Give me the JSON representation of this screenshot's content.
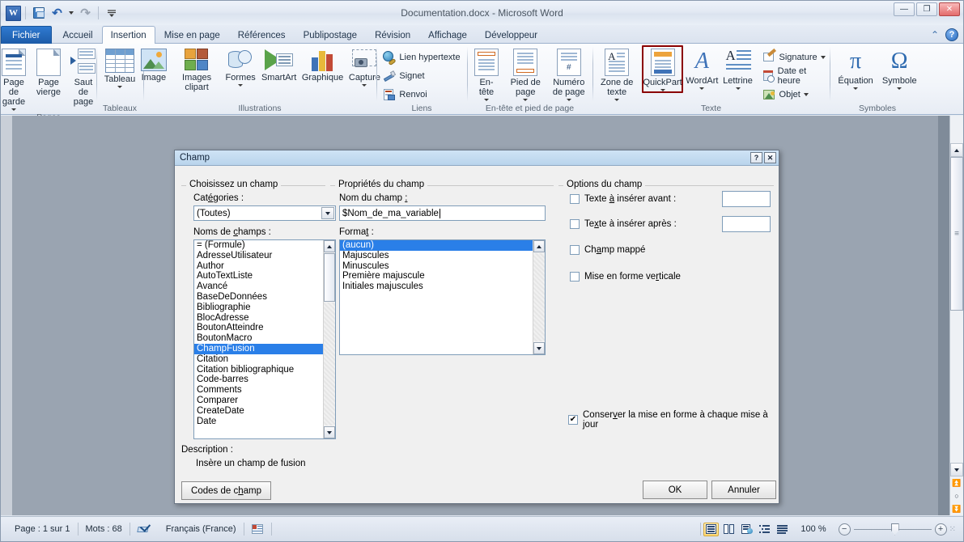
{
  "window": {
    "title": "Documentation.docx  -  Microsoft Word",
    "minimize": "—",
    "maximize": "❐",
    "close": "✕"
  },
  "quick_access": {
    "app_logo": "W",
    "save": "save-icon",
    "undo": "↺",
    "redo": "↻",
    "customize": "�striped"
  },
  "tabs": [
    {
      "label": "Fichier",
      "kind": "file"
    },
    {
      "label": "Accueil",
      "kind": "normal"
    },
    {
      "label": "Insertion",
      "kind": "active"
    },
    {
      "label": "Mise en page",
      "kind": "normal"
    },
    {
      "label": "Références",
      "kind": "normal"
    },
    {
      "label": "Publipostage",
      "kind": "normal"
    },
    {
      "label": "Révision",
      "kind": "normal"
    },
    {
      "label": "Affichage",
      "kind": "normal"
    },
    {
      "label": "Développeur",
      "kind": "normal"
    }
  ],
  "ribbon": {
    "groups": [
      {
        "name": "Pages",
        "label": "Pages",
        "buttons": [
          {
            "label": "Page de garde",
            "caret": true
          },
          {
            "label": "Page vierge",
            "caret": false
          },
          {
            "label": "Saut de page",
            "caret": false
          }
        ]
      },
      {
        "name": "Tableaux",
        "label": "Tableaux",
        "buttons": [
          {
            "label": "Tableau",
            "caret": true
          }
        ]
      },
      {
        "name": "Illustrations",
        "label": "Illustrations",
        "buttons": [
          {
            "label": "Image",
            "caret": false
          },
          {
            "label": "Images clipart",
            "caret": false
          },
          {
            "label": "Formes",
            "caret": true
          },
          {
            "label": "SmartArt",
            "caret": false
          },
          {
            "label": "Graphique",
            "caret": false
          },
          {
            "label": "Capture",
            "caret": true
          }
        ]
      },
      {
        "name": "Liens",
        "label": "Liens",
        "buttons": [
          {
            "label": "Lien hypertexte"
          },
          {
            "label": "Signet"
          },
          {
            "label": "Renvoi"
          }
        ]
      },
      {
        "name": "En-tête et pied de page",
        "label": "En-tête et pied de page",
        "buttons": [
          {
            "label": "En-tête",
            "caret": true
          },
          {
            "label": "Pied de page",
            "caret": true
          },
          {
            "label": "Numéro de page",
            "caret": true
          }
        ]
      },
      {
        "name": "Texte",
        "label": "Texte",
        "buttons": [
          {
            "label": "Zone de texte",
            "caret": true
          },
          {
            "label": "QuickPart",
            "caret": true,
            "highlighted": true
          },
          {
            "label": "WordArt",
            "caret": true
          },
          {
            "label": "Lettrine",
            "caret": true
          }
        ],
        "small_buttons": [
          {
            "label": "Signature",
            "caret": true
          },
          {
            "label": "Date et heure",
            "caret": false
          },
          {
            "label": "Objet",
            "caret": true
          }
        ]
      },
      {
        "name": "Symboles",
        "label": "Symboles",
        "buttons": [
          {
            "label": "Équation",
            "glyph": "π",
            "caret": true
          },
          {
            "label": "Symbole",
            "glyph": "Ω",
            "caret": true
          }
        ]
      }
    ],
    "minimize_ribbon": "⌃",
    "help": "?"
  },
  "dialog": {
    "title": "Champ",
    "help_button": "?",
    "close_button": "✕",
    "left_group": {
      "legend": "Choisissez un champ",
      "categories_label": "Catégories :",
      "categories_value": "(Toutes)",
      "field_names_label": "Noms de champs :",
      "field_names": [
        "= (Formule)",
        "AdresseUtilisateur",
        "Author",
        "AutoTextListe",
        "Avancé",
        "BaseDeDonnées",
        "Bibliographie",
        "BlocAdresse",
        "BoutonAtteindre",
        "BoutonMacro",
        "ChampFusion",
        "Citation",
        "Citation bibliographique",
        "Code-barres",
        "Comments",
        "Comparer",
        "CreateDate",
        "Date"
      ],
      "field_names_selected": "ChampFusion"
    },
    "middle_group": {
      "legend": "Propriétés du champ",
      "field_name_label": "Nom du champ :",
      "field_name_value": "$Nom_de_ma_variable",
      "format_label": "Format :",
      "formats": [
        "(aucun)",
        "Majuscules",
        "Minuscules",
        "Première majuscule",
        "Initiales majuscules"
      ],
      "format_selected": "(aucun)"
    },
    "right_group": {
      "legend": "Options du champ",
      "checkboxes": [
        {
          "label": "Texte à insérer avant :",
          "checked": false,
          "has_textbox": true,
          "textbox_value": ""
        },
        {
          "label": "Texte à insérer après :",
          "checked": false,
          "has_textbox": true,
          "textbox_value": ""
        },
        {
          "label": "Champ mappé",
          "checked": false,
          "has_textbox": false
        },
        {
          "label": "Mise en forme verticale",
          "checked": false,
          "has_textbox": false
        }
      ],
      "preserve_formatting": {
        "label": "Conserver la mise en forme à chaque mise à jour",
        "checked": true
      }
    },
    "description_label": "Description :",
    "description_text": "Insère un champ de fusion",
    "field_codes_button": "Codes de champ",
    "ok_button": "OK",
    "cancel_button": "Annuler"
  },
  "statusbar": {
    "page": "Page : 1 sur 1",
    "words": "Mots : 68",
    "proofing_icon": "spellcheck-icon",
    "language": "Français (France)",
    "macro_icon": "macro-record-icon",
    "views": [
      {
        "name": "print-layout",
        "glyph": "▤",
        "active": true
      },
      {
        "name": "full-screen-reading",
        "glyph": "📖",
        "active": false
      },
      {
        "name": "web-layout",
        "glyph": "🖹",
        "active": false
      },
      {
        "name": "outline",
        "glyph": "⊞",
        "active": false
      },
      {
        "name": "draft",
        "glyph": "≣",
        "active": false
      }
    ],
    "zoom_level": "100 %",
    "zoom_out": "−",
    "zoom_in": "+"
  }
}
